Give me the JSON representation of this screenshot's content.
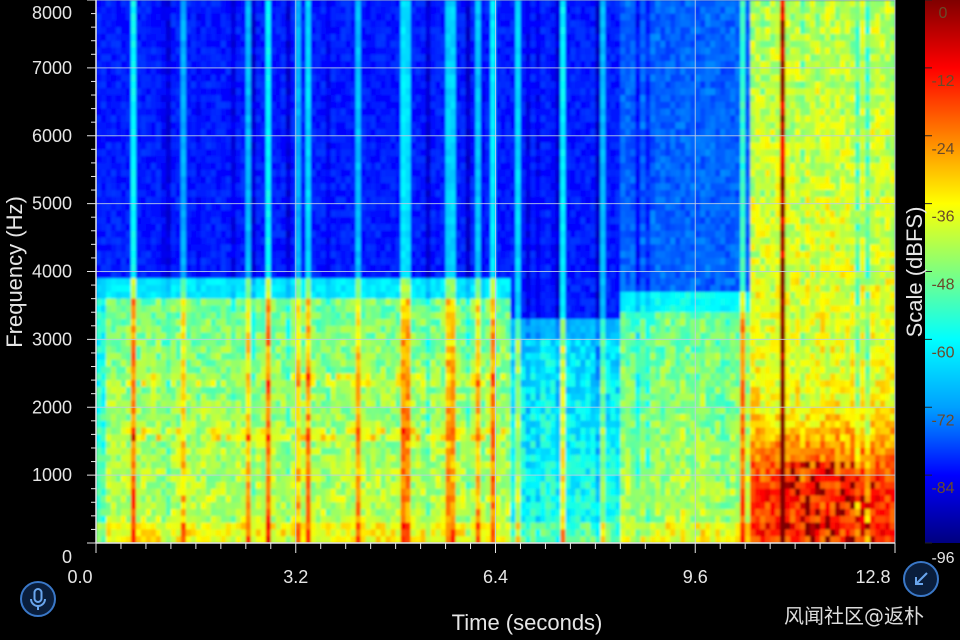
{
  "chart_data": {
    "type": "heatmap",
    "title": "",
    "xlabel": "Time (seconds)",
    "ylabel": "Frequency (Hz)",
    "colorbar_label": "Scale (dBFS)",
    "x_ticks": [
      "0.0",
      "3.2",
      "6.4",
      "9.6",
      "12.8"
    ],
    "x_tick_values": [
      0.0,
      3.2,
      6.4,
      9.6,
      12.8
    ],
    "y_ticks": [
      "0",
      "1000",
      "2000",
      "3000",
      "4000",
      "5000",
      "6000",
      "7000",
      "8000"
    ],
    "y_tick_values": [
      0,
      1000,
      2000,
      3000,
      4000,
      5000,
      6000,
      7000,
      8000
    ],
    "colorbar_ticks": [
      "0",
      "-12",
      "-24",
      "-36",
      "-48",
      "-60",
      "-72",
      "-84",
      "-96"
    ],
    "colorbar_tick_values": [
      0,
      -12,
      -24,
      -36,
      -48,
      -60,
      -72,
      -84,
      -96
    ],
    "xlim": [
      0,
      12.8
    ],
    "ylim": [
      0,
      8000
    ],
    "zlim": [
      -96,
      0
    ],
    "colormap": [
      "#000080",
      "#0000ff",
      "#00a0ff",
      "#00ffff",
      "#7fff7f",
      "#ffff00",
      "#ff8000",
      "#ff0000",
      "#800000"
    ],
    "grid": true,
    "colorbar_position": "right"
  },
  "controls": {
    "mic_icon": "microphone-icon",
    "fit_icon": "fit-screen-icon"
  },
  "watermark": "风闻社区@返朴",
  "colors": {
    "background": "#000000",
    "gridline": "#bfcfe6",
    "button_ring": "#3a78c8"
  }
}
